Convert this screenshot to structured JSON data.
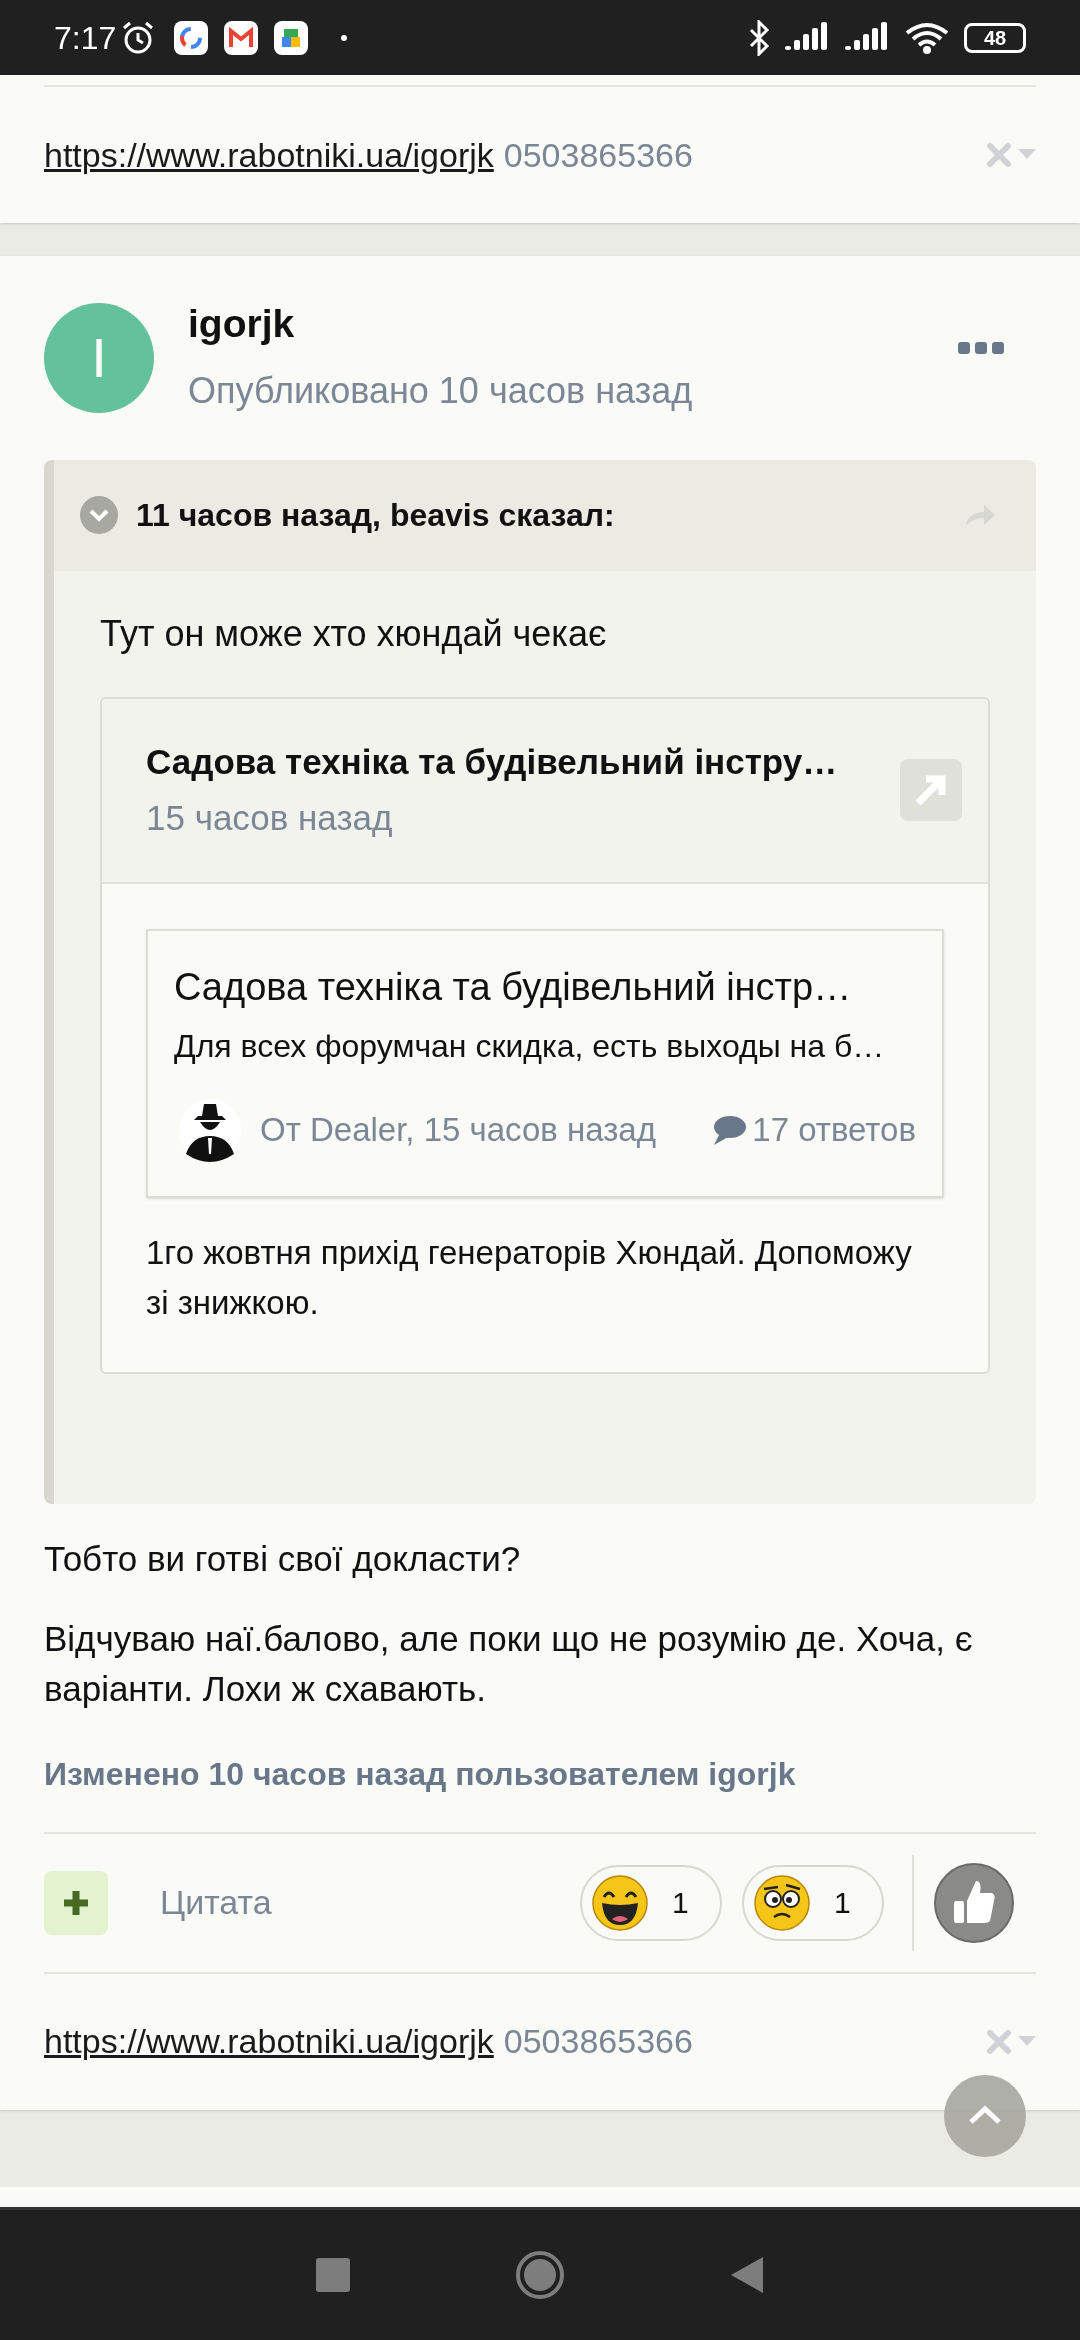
{
  "status_bar": {
    "time": "7:17",
    "battery": "48"
  },
  "top_signature": {
    "link": "https://www.rabotniki.ua/igorjk",
    "phone": "0503865366"
  },
  "post": {
    "avatar_letter": "I",
    "author": "igorjk",
    "published": "Опубликовано 10 часов назад",
    "quote": {
      "header": "11 часов назад, beavis сказал:",
      "text": "Тут он може хто хюндай чекає",
      "embed": {
        "title": "Садова техніка та будівельний інстру…",
        "time": "15 часов назад",
        "topic": {
          "title": "Садова техніка та будівельний інстр…",
          "excerpt": "Для всех форумчан скидка, есть выходы на б…",
          "meta": "От Dealer, 15 часов назад",
          "replies": "17 ответов"
        },
        "text": "1го жовтня прихід генераторів Хюндай. Допоможу зі знижкою."
      }
    },
    "paragraphs": [
      "Тобто ви готві свої докласти?",
      "Відчуваю наї.балово, але поки що не розумію де. Хоча, є варіанти. Лохи ж схавають."
    ],
    "edited": "Изменено 10 часов назад пользователем igorjk",
    "actions": {
      "quote_label": "Цитата",
      "reactions": [
        {
          "kind": "laugh",
          "count": "1"
        },
        {
          "kind": "confused",
          "count": "1"
        }
      ]
    },
    "signature": {
      "link": "https://www.rabotniki.ua/igorjk",
      "phone": "0503865366"
    }
  }
}
